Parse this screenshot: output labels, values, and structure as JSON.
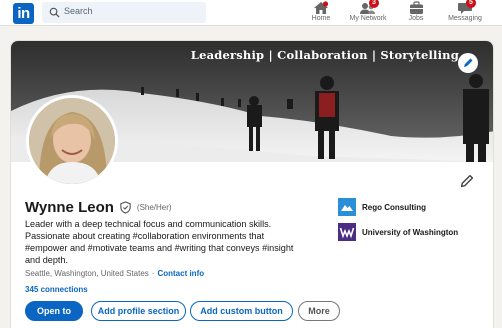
{
  "nav": {
    "logo_text": "in",
    "search_placeholder": "Search",
    "items": [
      {
        "label": "Home",
        "icon": "home-icon",
        "badge": ""
      },
      {
        "label": "My Network",
        "icon": "network-icon",
        "badge": "3"
      },
      {
        "label": "Jobs",
        "icon": "briefcase-icon",
        "badge": ""
      },
      {
        "label": "Messaging",
        "icon": "messaging-icon",
        "badge": "5"
      }
    ]
  },
  "banner": {
    "text": "Leadership | Collaboration | Storytelling"
  },
  "profile": {
    "name": "Wynne Leon",
    "pronouns": "(She/Her)",
    "headline_lines": [
      "Leader with a deep technical focus and communication skills.",
      "Passionate about creating #collaboration environments that",
      "#empower and #motivate teams and #writing that conveys #insight",
      "and depth."
    ],
    "location": "Seattle, Washington, United States",
    "location_sep": "·",
    "contact_label": "Contact info",
    "connections": "345 connections"
  },
  "organizations": [
    {
      "name": "Rego Consulting",
      "color": "#2a8fd6"
    },
    {
      "name": "University of Washington",
      "color": "#4b2e83"
    }
  ],
  "buttons": {
    "open_to": "Open to",
    "add_section": "Add profile section",
    "add_custom": "Add custom button",
    "more": "More"
  },
  "colors": {
    "brand": "#0a66c2",
    "badge": "#cc1016"
  }
}
